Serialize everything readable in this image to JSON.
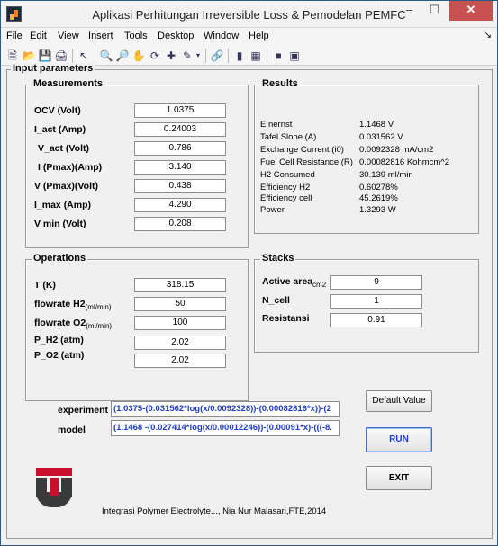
{
  "window": {
    "title": "Aplikasi Perhitungan Irreversible Loss & Pemodelan PEMFC"
  },
  "menu": [
    "File",
    "Edit",
    "View",
    "Insert",
    "Tools",
    "Desktop",
    "Window",
    "Help"
  ],
  "main_panel": {
    "title": "Input parameters"
  },
  "measurements": {
    "title": "Measurements",
    "rows": [
      {
        "label": "OCV (Volt)",
        "value": "1.0375"
      },
      {
        "label": "I_act (Amp)",
        "value": "0.24003"
      },
      {
        "label": "V_act (Volt)",
        "value": "0.786"
      },
      {
        "label": "I (Pmax)(Amp)",
        "value": "3.140"
      },
      {
        "label": "V (Pmax)(Volt)",
        "value": "0.438"
      },
      {
        "label": "I_max (Amp)",
        "value": "4.290"
      },
      {
        "label": "V  min (Volt)",
        "value": "0.208"
      }
    ]
  },
  "results": {
    "title": "Results",
    "rows": [
      {
        "label": "E nernst",
        "value": "1.1468 V"
      },
      {
        "label": "Tafel Slope (A)",
        "value": "0.031562 V"
      },
      {
        "label": "Exchange Current (i0)",
        "value": "0.0092328 mA/cm2"
      },
      {
        "label": "Fuel Cell Resistance (R)",
        "value": "0.00082816 Kohmcm^2"
      },
      {
        "label": "H2 Consumed",
        "value": "30.139 ml/min"
      },
      {
        "label": "Efficiency H2",
        "value": "0.60278%"
      },
      {
        "label": "Efficiency cell",
        "value": "45.2619%"
      },
      {
        "label": "Power",
        "value": "1.3293 W"
      }
    ]
  },
  "operations": {
    "title": "Operations",
    "rows": [
      {
        "label": "T (K)",
        "sub": "",
        "value": "318.15"
      },
      {
        "label": "flowrate H2",
        "sub": "(ml/min)",
        "value": "50"
      },
      {
        "label": "flowrate O2",
        "sub": "(ml/min)",
        "value": "100"
      },
      {
        "label": "P_H2 (atm)",
        "sub": "",
        "value": "2.02"
      },
      {
        "label": "P_O2 (atm)",
        "sub": "",
        "value": "2.02"
      }
    ]
  },
  "stacks": {
    "title": "Stacks",
    "rows": [
      {
        "label": "Active area",
        "sub": "cm2",
        "value": "9"
      },
      {
        "label": "N_cell",
        "sub": "",
        "value": "1"
      },
      {
        "label": "Resistansi",
        "sub": "",
        "value": "0.91"
      }
    ]
  },
  "equations": {
    "experiment_label": "experiment",
    "experiment_value": "(1.0375-(0.031562*log(x/0.0092328))-(0.00082816*x))-(2",
    "model_label": "model",
    "model_value": "(1.1468 -(0.027414*log(x/0.00012246))-(0.00091*x)-(((-8."
  },
  "buttons": {
    "default": "Default Value",
    "run": "RUN",
    "exit": "EXIT"
  },
  "footer": "Integrasi Polymer Electrolyte..., Nia Nur Malasari,FTE,2014"
}
